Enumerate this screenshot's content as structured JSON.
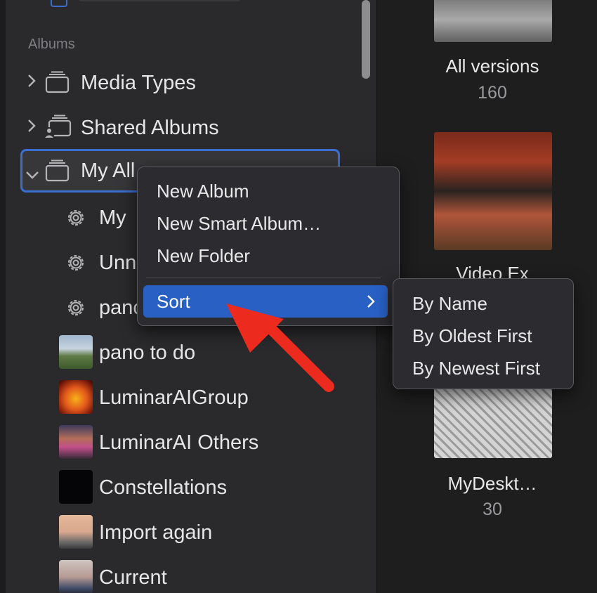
{
  "sidebar": {
    "section_label": "Albums",
    "items": [
      {
        "label": "Media Types",
        "icon": "folder-stack-icon",
        "chevron": "chevron-right"
      },
      {
        "label": "Shared Albums",
        "icon": "shared-folder-icon",
        "chevron": "chevron-right"
      },
      {
        "label": "My Albums",
        "icon": "folder-stack-icon",
        "chevron": "chevron-down",
        "visible_label": "My All"
      },
      {
        "label": "My",
        "icon": "gear-icon"
      },
      {
        "label": "Unn",
        "icon": "gear-icon"
      },
      {
        "label": "pano",
        "icon": "gear-icon"
      },
      {
        "label": "pano to do",
        "icon": "photo-thumb"
      },
      {
        "label": "LuminarAIGroup",
        "icon": "photo-thumb"
      },
      {
        "label": "LuminarAI Others",
        "icon": "photo-thumb"
      },
      {
        "label": "Constellations",
        "icon": "photo-thumb"
      },
      {
        "label": "Import again",
        "icon": "photo-thumb"
      },
      {
        "label": "Current",
        "icon": "photo-thumb"
      }
    ]
  },
  "context_menu": {
    "items": [
      "New Album",
      "New Smart Album…",
      "New Folder"
    ],
    "sort_label": "Sort"
  },
  "submenu": {
    "items": [
      "By Name",
      "By Oldest First",
      "By Newest First"
    ]
  },
  "grid": {
    "tiles": [
      {
        "name": "All versions",
        "count": "160"
      },
      {
        "name": "Video Ex"
      },
      {
        "name": "MyDeskt…",
        "count": "30"
      }
    ]
  },
  "colors": {
    "accent": "#2860c4",
    "selection_border": "#3a6ed0",
    "arrow": "#ec2a1e"
  }
}
